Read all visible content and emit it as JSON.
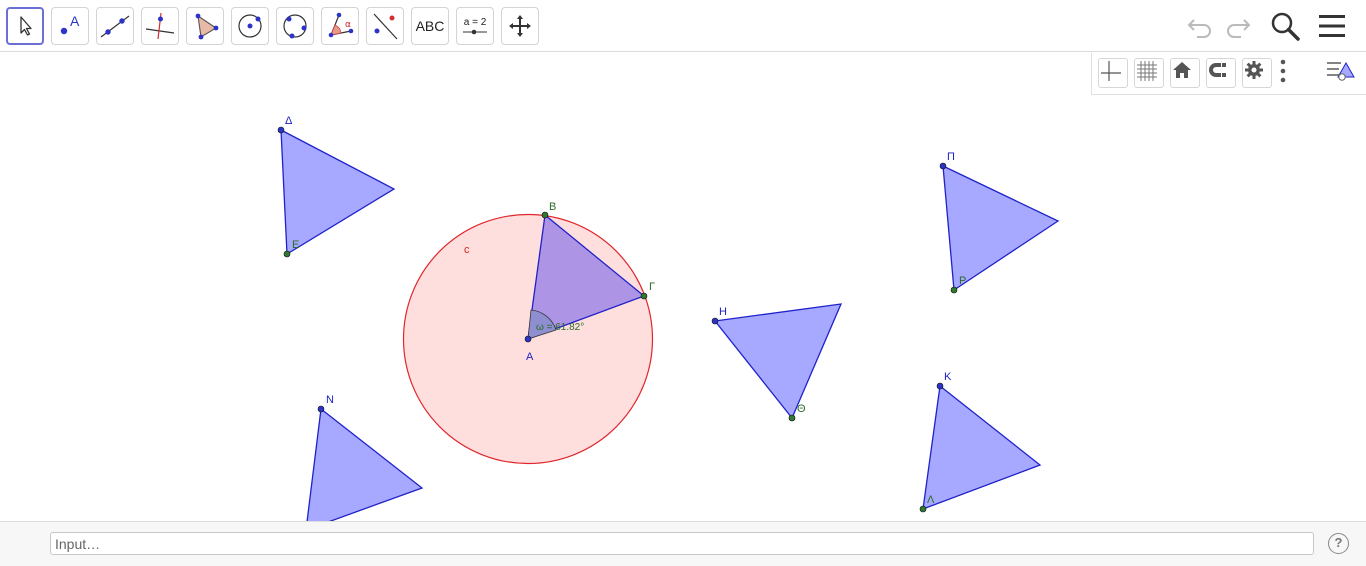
{
  "toolbar": {
    "tools": [
      {
        "id": "move",
        "icon": "move-arrow-icon"
      },
      {
        "id": "point",
        "icon": "point-icon",
        "glyph": "A"
      },
      {
        "id": "line",
        "icon": "line-through-points-icon"
      },
      {
        "id": "perpendicular",
        "icon": "perpendicular-line-icon"
      },
      {
        "id": "polygon",
        "icon": "polygon-icon"
      },
      {
        "id": "circle-center-point",
        "icon": "circle-center-point-icon"
      },
      {
        "id": "circle-three-points",
        "icon": "circle-three-points-icon"
      },
      {
        "id": "angle",
        "icon": "angle-icon",
        "glyph": "α"
      },
      {
        "id": "reflect-line",
        "icon": "reflect-about-line-icon"
      },
      {
        "id": "text",
        "icon": "text-tool-icon",
        "label": "ABC"
      },
      {
        "id": "slider",
        "icon": "slider-icon",
        "label": "a = 2"
      },
      {
        "id": "move-graphics",
        "icon": "move-graphics-view-icon"
      }
    ],
    "active_tool": "move",
    "right_icons": [
      "undo-icon",
      "redo-icon",
      "search-icon",
      "menu-icon"
    ]
  },
  "stylebar": {
    "buttons": [
      "axes-icon",
      "grid-icon",
      "home-icon",
      "point-capturing-icon",
      "settings-icon",
      "more-vert-icon",
      "graphics-style-icon"
    ]
  },
  "canvas": {
    "circle": {
      "name": "c",
      "fill": "#ffdede",
      "stroke": "#e0262b"
    },
    "angle_label": "ω = 61.82°",
    "points": {
      "A": "A",
      "B": "B",
      "Gamma": "Γ",
      "Delta": "Δ",
      "E": "E",
      "H": "H",
      "Theta": "Θ",
      "Pi": "Π",
      "P": "Ρ",
      "K": "K",
      "Lambda": "Λ",
      "N": "N"
    },
    "colors": {
      "triangle_fill": "#a6a9ff",
      "triangle_stroke": "#1f22c9",
      "inscribed_fill": "#ad94e4",
      "point_blue": "#2c34c8",
      "point_green": "#2f7a2f",
      "label_blue": "#1a1fbf",
      "label_green": "#2b6b2b",
      "label_red": "#d42020"
    }
  },
  "inputbar": {
    "placeholder": "Input…",
    "help_label": "?"
  }
}
